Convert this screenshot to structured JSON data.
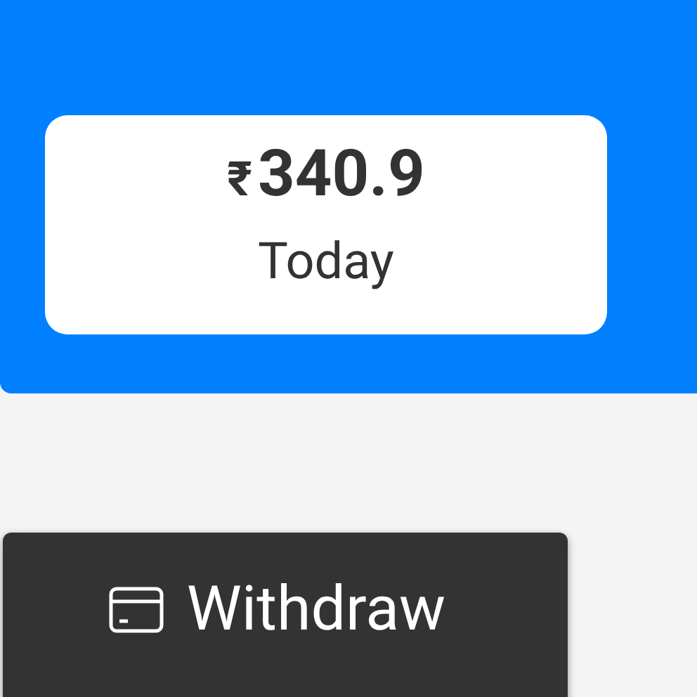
{
  "balance": {
    "currency": "₹",
    "amount": "340.9",
    "period": "Today"
  },
  "withdraw_button": {
    "label": "Withdraw"
  }
}
